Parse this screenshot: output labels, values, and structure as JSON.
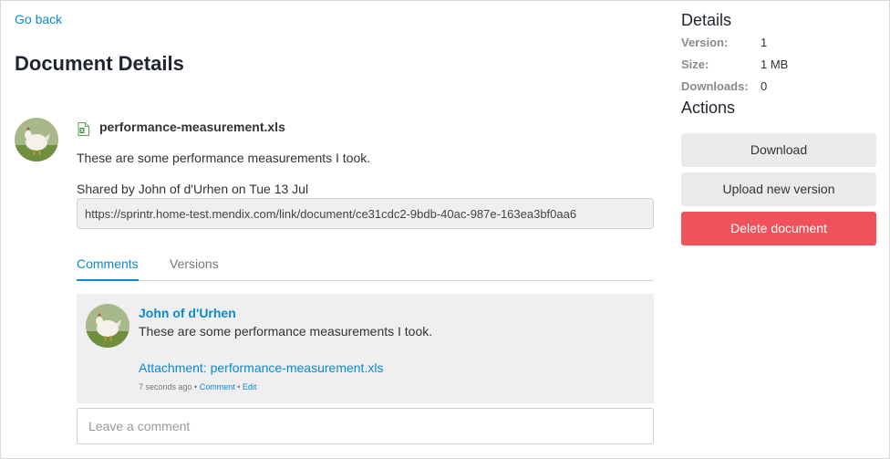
{
  "nav": {
    "back_label": "Go back"
  },
  "page": {
    "title": "Document Details"
  },
  "document": {
    "file_icon": "spreadsheet-file-icon",
    "file_name": "performance-measurement.xls",
    "description": "These are some performance measurements I took.",
    "shared_by": "Shared by John of d'Urhen on Tue 13 Jul",
    "share_link": "https://sprintr.home-test.mendix.com/link/document/ce31cdc2-9bdb-40ac-987e-163ea3bf0aa6"
  },
  "tabs": [
    {
      "label": "Comments",
      "active": true
    },
    {
      "label": "Versions",
      "active": false
    }
  ],
  "comments": [
    {
      "author": "John of d'Urhen",
      "text": "These are some performance measurements I took.",
      "attachment": "Attachment: performance-measurement.xls",
      "time": "7 seconds ago",
      "sep1": " • ",
      "comment_link": "Comment",
      "sep2": " • ",
      "edit_link": "Edit"
    }
  ],
  "comment_input": {
    "placeholder": "Leave a comment"
  },
  "details": {
    "heading": "Details",
    "rows": [
      {
        "label": "Version:",
        "value": "1"
      },
      {
        "label": "Size:",
        "value": "1 MB"
      },
      {
        "label": "Downloads:",
        "value": "0"
      }
    ]
  },
  "actions": {
    "heading": "Actions",
    "download": "Download",
    "upload": "Upload new version",
    "delete": "Delete document"
  },
  "colors": {
    "link": "#0a8ad0",
    "danger": "#ef525b",
    "panel": "#efefef"
  }
}
